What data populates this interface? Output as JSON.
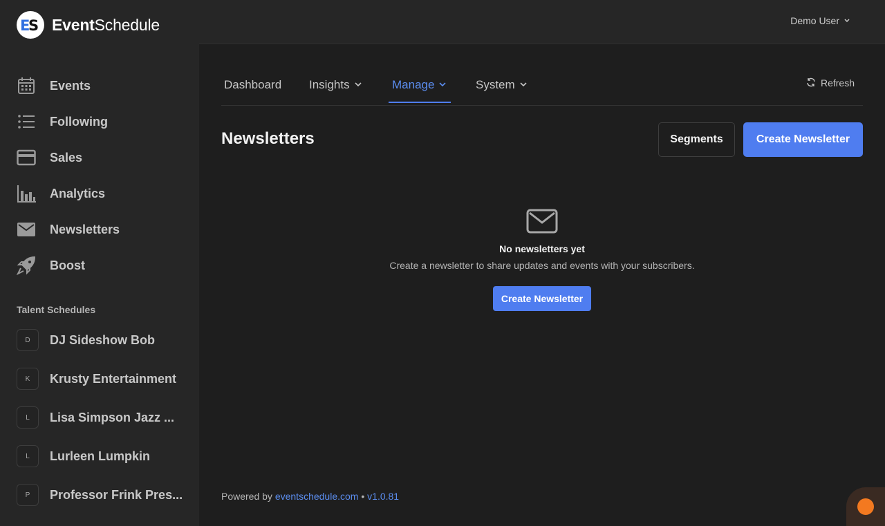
{
  "app": {
    "logo_bold": "Event",
    "logo_regular": "Schedule"
  },
  "sidebar": {
    "items": [
      {
        "label": "Events",
        "icon": "calendar-icon"
      },
      {
        "label": "Following",
        "icon": "list-icon"
      },
      {
        "label": "Sales",
        "icon": "credit-card-icon"
      },
      {
        "label": "Analytics",
        "icon": "bar-chart-icon"
      },
      {
        "label": "Newsletters",
        "icon": "envelope-icon"
      },
      {
        "label": "Boost",
        "icon": "rocket-icon"
      }
    ],
    "talent_title": "Talent Schedules",
    "talent": [
      {
        "initial": "D",
        "name": "DJ Sideshow Bob"
      },
      {
        "initial": "K",
        "name": "Krusty Entertainment"
      },
      {
        "initial": "L",
        "name": "Lisa Simpson Jazz ..."
      },
      {
        "initial": "L",
        "name": "Lurleen Lumpkin"
      },
      {
        "initial": "P",
        "name": "Professor Frink Pres..."
      }
    ]
  },
  "topbar": {
    "user_name": "Demo User"
  },
  "tabs": {
    "dashboard": "Dashboard",
    "insights": "Insights",
    "manage": "Manage",
    "system": "System",
    "refresh": "Refresh"
  },
  "main": {
    "title": "Newsletters",
    "segments_label": "Segments",
    "create_label": "Create Newsletter",
    "empty_title": "No newsletters yet",
    "empty_desc": "Create a newsletter to share updates and events with your subscribers.",
    "empty_button": "Create Newsletter"
  },
  "footer": {
    "powered_by": "Powered by",
    "link_text": "eventschedule.com",
    "separator": "•",
    "version": "v1.0.81"
  },
  "colors": {
    "accent": "#4f7df0",
    "chat": "#f37920"
  }
}
